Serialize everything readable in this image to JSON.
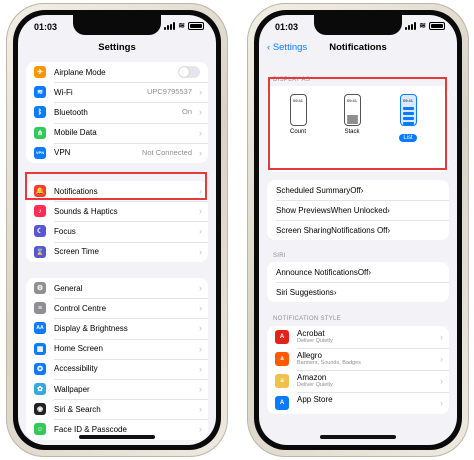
{
  "left_phone": {
    "status_time": "01:03",
    "nav_title": "Settings",
    "group1": [
      {
        "label": "Airplane Mode",
        "value": "",
        "icon": "airplane-icon",
        "color": "#ff9500",
        "glyph": "✈",
        "toggle": true
      },
      {
        "label": "Wi-Fi",
        "value": "UPC9795537",
        "icon": "wifi-icon",
        "color": "#0a7aff",
        "glyph": "≋"
      },
      {
        "label": "Bluetooth",
        "value": "On",
        "icon": "bluetooth-icon",
        "color": "#0a7aff",
        "glyph": "ᛒ"
      },
      {
        "label": "Mobile Data",
        "value": "",
        "icon": "antenna-icon",
        "color": "#34c759",
        "glyph": "⋔"
      },
      {
        "label": "VPN",
        "value": "Not Connected",
        "icon": "vpn-icon",
        "color": "#0a7aff",
        "glyph": "VPN"
      }
    ],
    "group2": [
      {
        "label": "Notifications",
        "value": "",
        "icon": "bell-icon",
        "color": "#ff3b30",
        "glyph": "🔔"
      },
      {
        "label": "Sounds & Haptics",
        "value": "",
        "icon": "speaker-icon",
        "color": "#ff2d55",
        "glyph": "♪"
      },
      {
        "label": "Focus",
        "value": "",
        "icon": "moon-icon",
        "color": "#5856d6",
        "glyph": "☾"
      },
      {
        "label": "Screen Time",
        "value": "",
        "icon": "hourglass-icon",
        "color": "#5856d6",
        "glyph": "⌛"
      }
    ],
    "group3": [
      {
        "label": "General",
        "value": "",
        "icon": "gear-icon",
        "color": "#8e8e93",
        "glyph": "⚙"
      },
      {
        "label": "Control Centre",
        "value": "",
        "icon": "sliders-icon",
        "color": "#8e8e93",
        "glyph": "≡"
      },
      {
        "label": "Display & Brightness",
        "value": "",
        "icon": "text-size-icon",
        "color": "#0a7aff",
        "glyph": "AA"
      },
      {
        "label": "Home Screen",
        "value": "",
        "icon": "grid-icon",
        "color": "#0a7aff",
        "glyph": "▦"
      },
      {
        "label": "Accessibility",
        "value": "",
        "icon": "accessibility-icon",
        "color": "#0a7aff",
        "glyph": "✪"
      },
      {
        "label": "Wallpaper",
        "value": "",
        "icon": "flower-icon",
        "color": "#34aadc",
        "glyph": "✿"
      },
      {
        "label": "Siri & Search",
        "value": "",
        "icon": "siri-icon",
        "color": "#222222",
        "glyph": "◉"
      },
      {
        "label": "Face ID & Passcode",
        "value": "",
        "icon": "face-id-icon",
        "color": "#34c759",
        "glyph": "☺"
      }
    ]
  },
  "right_phone": {
    "status_time": "01:03",
    "back_label": "Settings",
    "nav_title": "Notifications",
    "display_as_header": "DISPLAY AS",
    "styles": [
      {
        "label": "Count",
        "time": "09:41",
        "selected": false
      },
      {
        "label": "Stack",
        "time": "09:41",
        "selected": false
      },
      {
        "label": "List",
        "time": "09:41",
        "selected": true
      }
    ],
    "group_a": [
      {
        "label": "Scheduled Summary",
        "value": "Off"
      },
      {
        "label": "Show Previews",
        "value": "When Unlocked"
      },
      {
        "label": "Screen Sharing",
        "value": "Notifications Off"
      }
    ],
    "siri_header": "SIRI",
    "group_b": [
      {
        "label": "Announce Notifications",
        "value": "Off"
      },
      {
        "label": "Siri Suggestions",
        "value": ""
      }
    ],
    "style_header": "NOTIFICATION STYLE",
    "apps": [
      {
        "name": "Acrobat",
        "sub": "Deliver Quietly",
        "icon": "acrobat-icon",
        "color": "#e2231a",
        "glyph": "A"
      },
      {
        "name": "Allegro",
        "sub": "Banners, Sounds, Badges",
        "icon": "allegro-icon",
        "color": "#ff5a00",
        "glyph": "a"
      },
      {
        "name": "Amazon",
        "sub": "Deliver Quietly",
        "icon": "amazon-icon",
        "color": "#f0c14b",
        "glyph": "a"
      },
      {
        "name": "App Store",
        "sub": "",
        "icon": "app-store-icon",
        "color": "#0a7aff",
        "glyph": "A"
      }
    ]
  }
}
